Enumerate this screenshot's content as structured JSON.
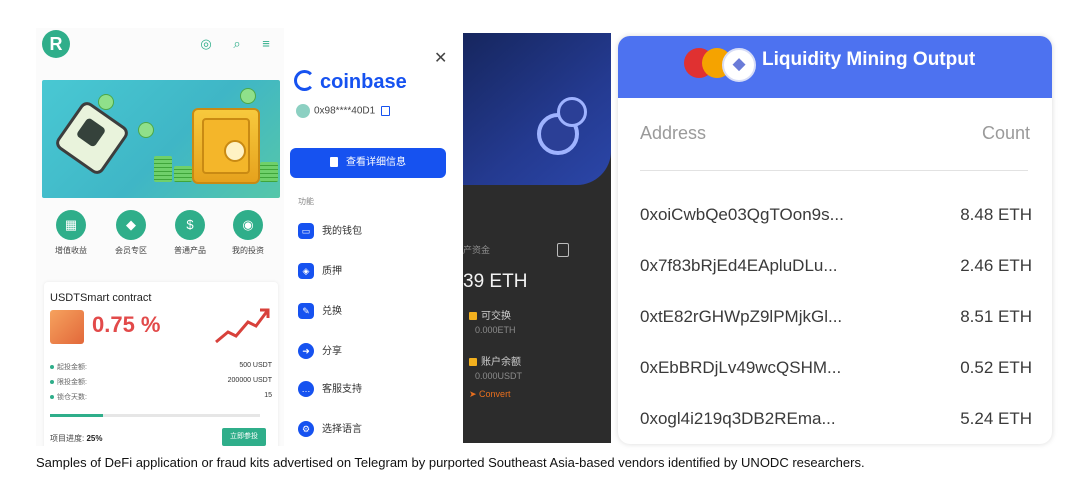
{
  "panel1": {
    "logo_letter": "R",
    "nav_items": [
      {
        "label": "增值收益",
        "icon": "chart-icon"
      },
      {
        "label": "会员专区",
        "icon": "diamond-icon"
      },
      {
        "label": "普通产品",
        "icon": "moneybag-icon"
      },
      {
        "label": "我的投资",
        "icon": "coin-icon"
      }
    ],
    "contract": {
      "title": "USDTSmart contract",
      "percent": "0.75 %",
      "rows": [
        {
          "label": "起投金额:",
          "value": "500 USDT"
        },
        {
          "label": "限投金额:",
          "value": "200000 USDT"
        },
        {
          "label": "锁仓天数:",
          "value": "15"
        }
      ],
      "progress_label": "项目进度:",
      "progress_value": "25%",
      "progress_fraction": 0.25,
      "join_button": "立即参投"
    },
    "accent_color": "#2fae8a"
  },
  "panel2": {
    "brand": "coinbase",
    "address": "0x98****40D1",
    "detail_button": "查看详细信息",
    "section_title": "功能",
    "menu_items": [
      {
        "label": "我的钱包",
        "icon": "wallet-icon"
      },
      {
        "label": "质押",
        "icon": "stake-icon"
      },
      {
        "label": "兑换",
        "icon": "exchange-icon"
      },
      {
        "label": "分享",
        "icon": "share-icon"
      },
      {
        "label": "客服支持",
        "icon": "support-icon"
      },
      {
        "label": "选择语言",
        "icon": "language-icon"
      }
    ],
    "accent_color": "#1652f0"
  },
  "panel3": {
    "asset_label": "产资金",
    "eth_value": "39 ETH",
    "exchangeable_label": "可交换",
    "exchangeable_value": "0.000ETH",
    "balance_label": "账户余额",
    "balance_value": "0.000USDT",
    "convert_label": "Convert"
  },
  "panel4": {
    "title": "Liquidity Mining Output",
    "col_address": "Address",
    "col_count": "Count",
    "rows": [
      {
        "address": "0xoiCwbQe03QgTOon9s...",
        "count": "8.48  ETH"
      },
      {
        "address": "0x7f83bRjEd4EApluDLu...",
        "count": "2.46  ETH"
      },
      {
        "address": "0xtE82rGHWpZ9lPMjkGl...",
        "count": "8.51  ETH"
      },
      {
        "address": "0xEbBRDjLv49wcQSHM...",
        "count": "0.52  ETH"
      },
      {
        "address": "0xogl4i219q3DB2REma...",
        "count": "5.24  ETH"
      }
    ],
    "header_color": "#4d72f0"
  },
  "caption": "Samples of DeFi application or fraud kits advertised on Telegram by purported Southeast Asia-based vendors identified by UNODC researchers."
}
